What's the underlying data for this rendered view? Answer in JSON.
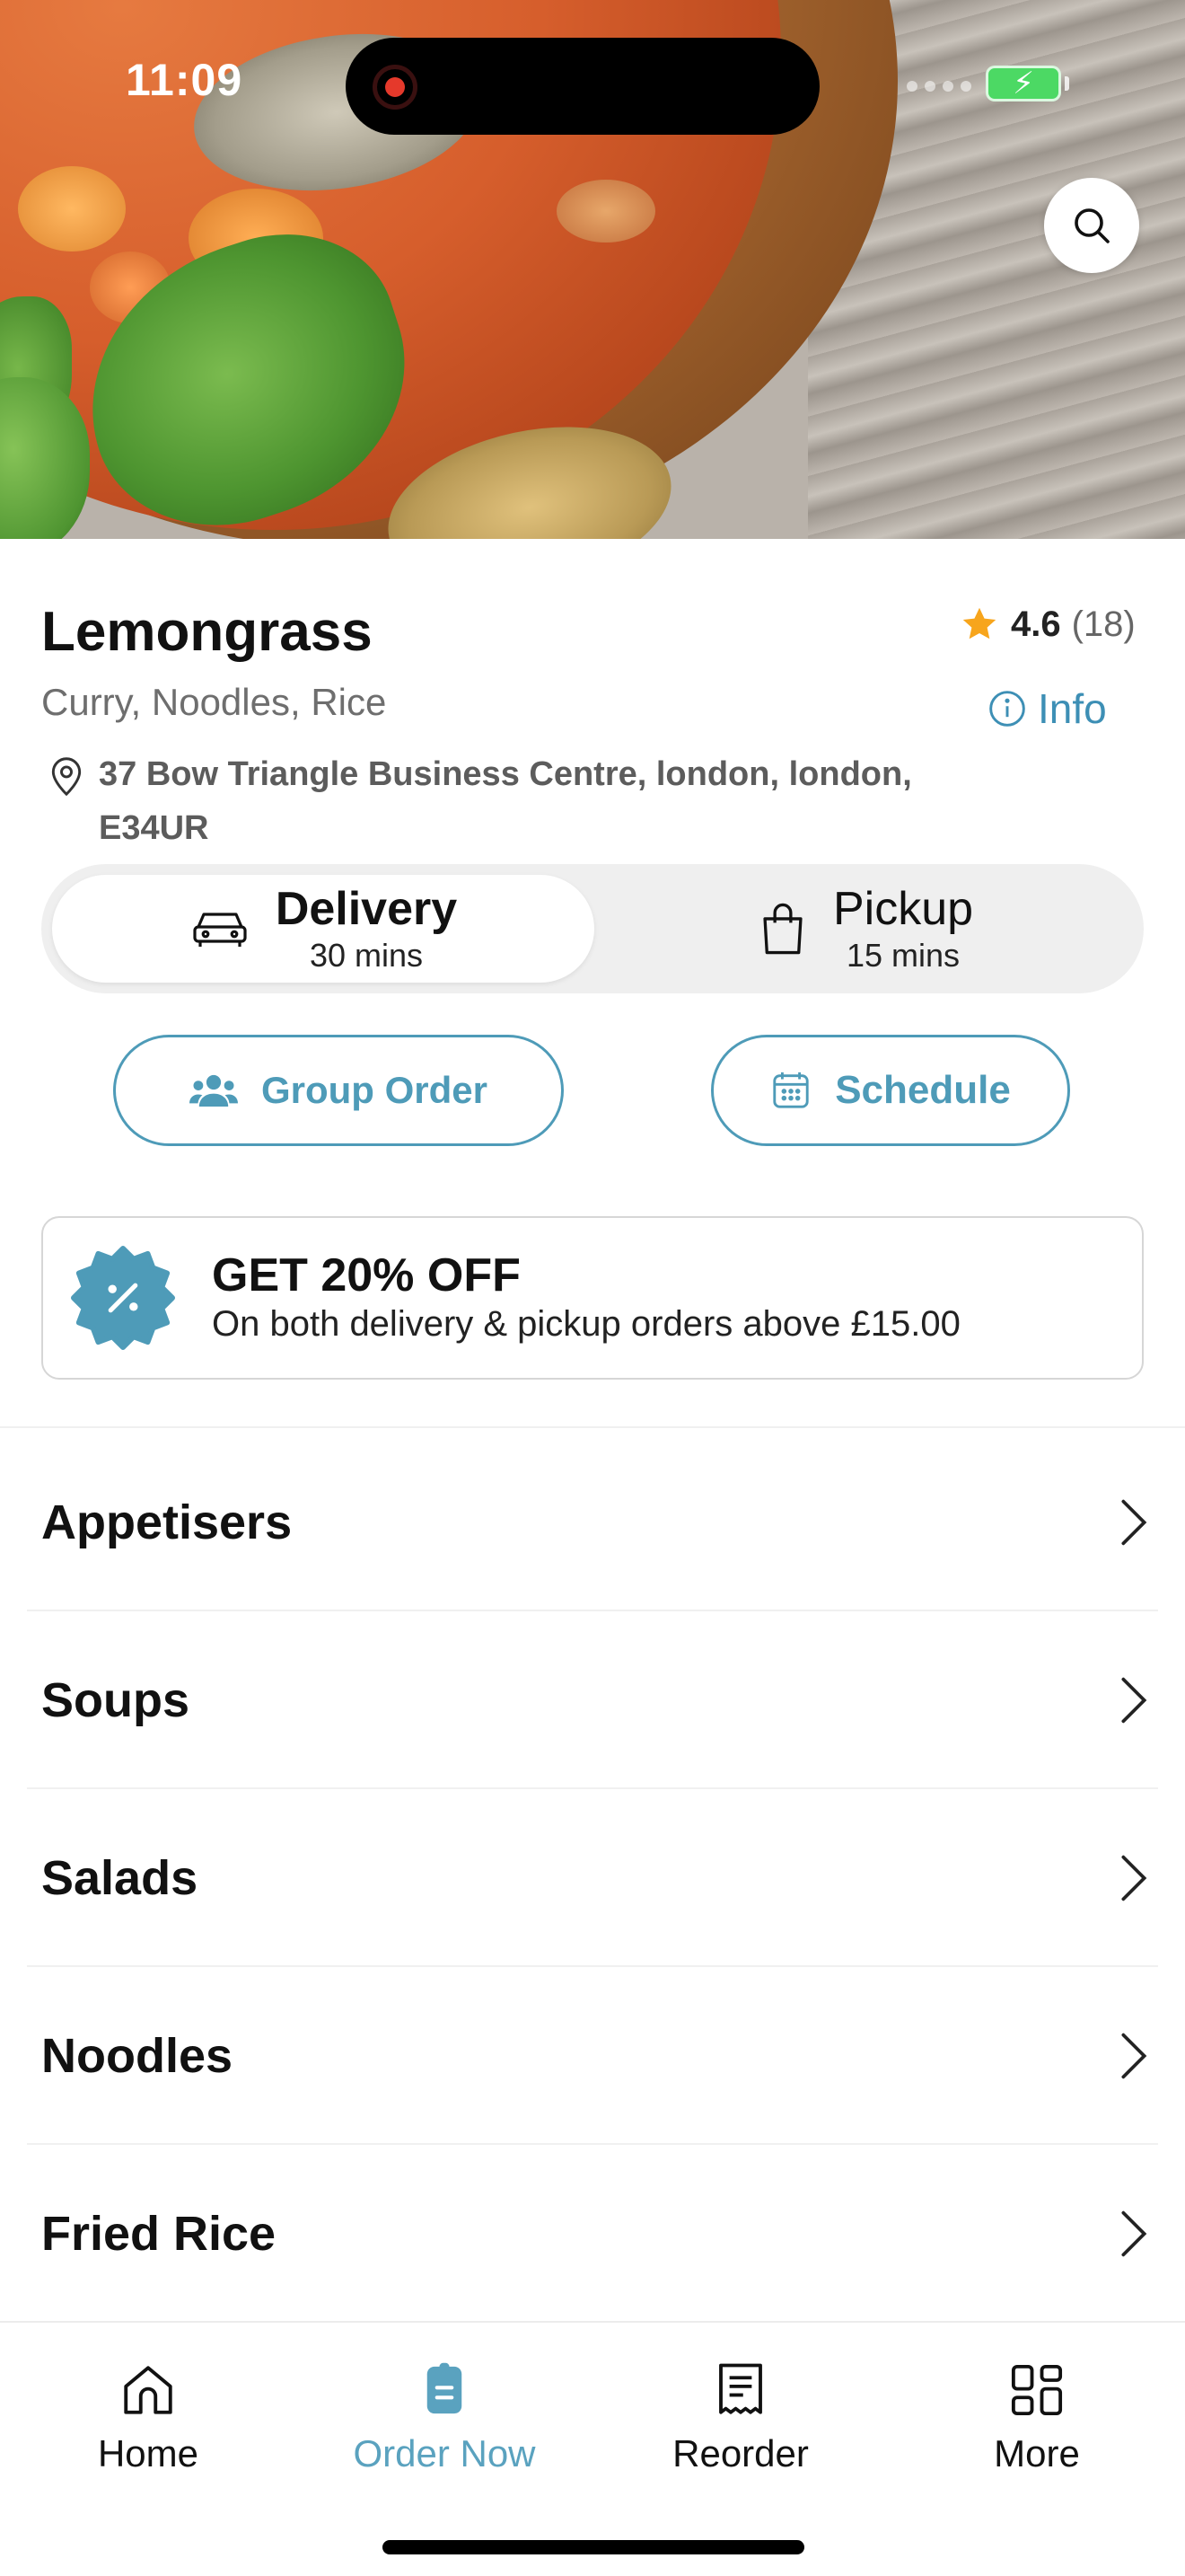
{
  "status_bar": {
    "time": "11:09"
  },
  "restaurant": {
    "name": "Lemongrass",
    "rating": "4.6",
    "rating_count": "(18)",
    "cuisines": "Curry, Noodles, Rice",
    "info_label": "Info",
    "address": "37 Bow Triangle Business Centre, london, london, E34UR"
  },
  "order_mode": {
    "delivery": {
      "label": "Delivery",
      "time": "30 mins",
      "selected": true
    },
    "pickup": {
      "label": "Pickup",
      "time": "15 mins",
      "selected": false
    }
  },
  "actions": {
    "group_order": "Group Order",
    "schedule": "Schedule"
  },
  "promo": {
    "title": "GET 20% OFF",
    "subtitle": "On both delivery & pickup orders above £15.00"
  },
  "categories": [
    "Appetisers",
    "Soups",
    "Salads",
    "Noodles",
    "Fried Rice"
  ],
  "bottom_nav": {
    "items": [
      {
        "label": "Home",
        "icon": "home-icon",
        "active": false
      },
      {
        "label": "Order Now",
        "icon": "order-icon",
        "active": true
      },
      {
        "label": "Reorder",
        "icon": "receipt-icon",
        "active": false
      },
      {
        "label": "More",
        "icon": "grid-icon",
        "active": false
      }
    ]
  },
  "colors": {
    "accent": "#4e9bb8",
    "star": "#f7a51c",
    "battery": "#4cd964",
    "recording": "#e5392b"
  }
}
